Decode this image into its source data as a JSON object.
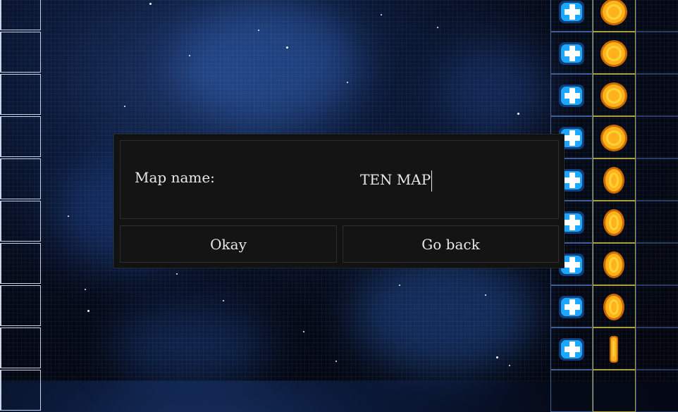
{
  "dialog": {
    "field_label": "Map name:",
    "field_value": "TEN MAP",
    "okay_label": "Okay",
    "back_label": "Go back"
  },
  "palette": {
    "dialog_bg": "#121212",
    "text": "#e8e8e8",
    "tile_blue": "#1da8ff",
    "coin_gold": "#ffb21a"
  },
  "palette_tiles": {
    "blue_column_icon": "heal-cross-icon",
    "gold_column_icons": [
      "coin-icon",
      "coin-icon",
      "coin-icon",
      "coin-icon",
      "coin-icon",
      "coin-icon",
      "coin-icon",
      "coin-icon",
      "coin-edge-icon"
    ]
  }
}
